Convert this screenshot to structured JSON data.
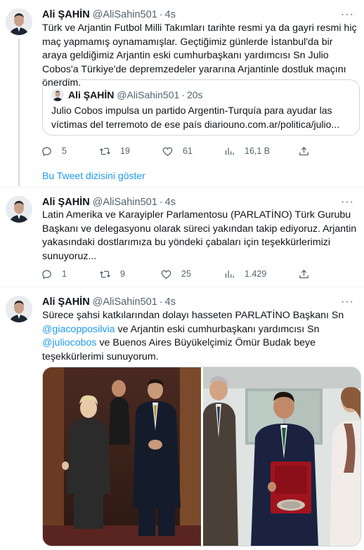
{
  "tweets": [
    {
      "name": "Ali ŞAHİN",
      "handle": "@AliSahin501",
      "separator": "·",
      "time": "4s",
      "text": "Türk ve Arjantin Futbol Milli Takımları tarihte resmi ya da gayri resmi hiç maç yapmamış oynamamışlar. Geçtiğimiz günlerde İstanbul'da bir araya geldiğimiz Arjantin eski cumhurbaşkanı yardımcısı Sn Julio Cobos'a Türkiye'de depremzedeler yararına Arjantinle dostluk maçını önerdim.",
      "quote": {
        "name": "Ali ŞAHİN",
        "handle": "@AliSahin501",
        "separator": "·",
        "time": "20s",
        "text": "Julio Cobos impulsa un partido Argentin-Turquía para ayudar las víctimas del terremoto de ese país diariouno.com.ar/politica/julio..."
      },
      "stats": {
        "replies": "5",
        "retweets": "19",
        "likes": "61",
        "views": "16,1 B"
      },
      "show_thread": "Bu Tweet dizisini göster"
    },
    {
      "name": "Ali ŞAHİN",
      "handle": "@AliSahin501",
      "separator": "·",
      "time": "4s",
      "text": "Latin Amerika ve Karayipler Parlamentosu (PARLATİNO) Türk Gurubu Başkanı ve delegasyonu olarak süreci yakından takip ediyoruz. Arjantin yakasındaki dostlarımıza bu yöndeki çabaları için teşekkürlerimizi sunuyoruz...",
      "stats": {
        "replies": "1",
        "retweets": "9",
        "likes": "25",
        "views": "1.429"
      }
    },
    {
      "name": "Ali ŞAHİN",
      "handle": "@AliSahin501",
      "separator": "·",
      "time": "4s",
      "text_parts": {
        "p1": "Sürece şahsi katkılarından dolayı hasseten PARLATİNO Başkanı Sn ",
        "mention1": "@giacopposilvia",
        "p2": " ve Arjantin eski cumhurbaşkanı yardımcısı Sn ",
        "mention2": "@juliocobos",
        "p3": " ve Buenos Aires Büyükelçimiz Ömür Budak beye teşekkürlerimi sunuyorum."
      }
    }
  ],
  "more_label": "···",
  "colors": {
    "accent": "#1d9bf0",
    "muted": "#536471",
    "border": "#cfd9de"
  },
  "icons": [
    "reply-icon",
    "retweet-icon",
    "like-icon",
    "views-icon",
    "share-icon",
    "more-icon"
  ]
}
